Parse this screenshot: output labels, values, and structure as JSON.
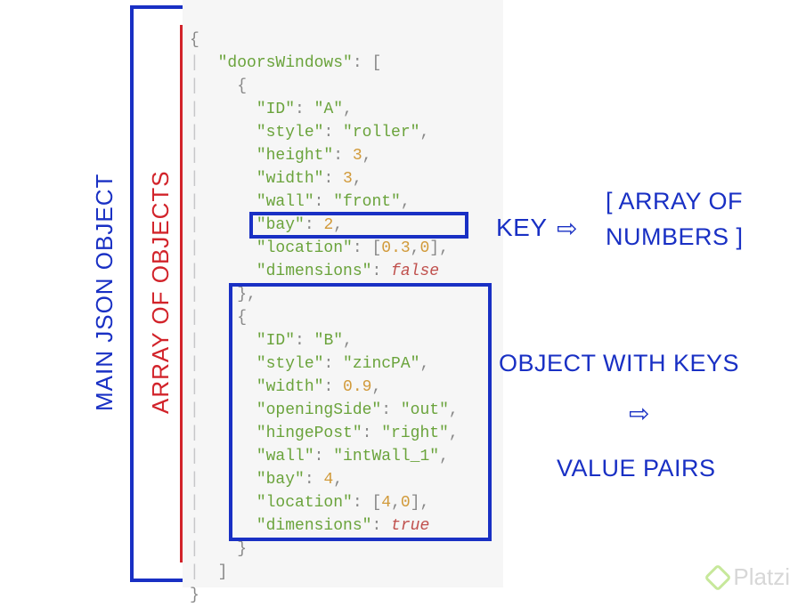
{
  "labels": {
    "main_json_object": "MAIN JSON OBJECT",
    "array_of_objects": "ARRAY OF OBJECTS",
    "key": "KEY",
    "array_of_numbers_l1": "[ ARRAY OF",
    "array_of_numbers_l2": "NUMBERS ]",
    "object_keys": "OBJECT WITH KEYS",
    "value_pairs": "VALUE PAIRS",
    "arrow_glyph": "⇨"
  },
  "code": {
    "outer_open": "{",
    "outer_close": "}",
    "key_doorsWindows": "\"doorsWindows\"",
    "arr_open": "[",
    "arr_close": "]",
    "obj_open": "{",
    "obj_close_comma": "},",
    "obj_close": "}",
    "colon_space": ": ",
    "comma": ",",
    "itemA": {
      "k_ID": "\"ID\"",
      "v_ID": "\"A\"",
      "k_style": "\"style\"",
      "v_style": "\"roller\"",
      "k_height": "\"height\"",
      "v_height": "3",
      "k_width": "\"width\"",
      "v_width": "3",
      "k_wall": "\"wall\"",
      "v_wall": "\"front\"",
      "k_bay": "\"bay\"",
      "v_bay": "2",
      "k_location": "\"location\"",
      "v_loc_open": "[",
      "v_loc_a": "0.3",
      "v_loc_sep": ",",
      "v_loc_b": "0",
      "v_loc_close": "]",
      "k_dimensions": "\"dimensions\"",
      "v_dimensions": "false"
    },
    "itemB": {
      "k_ID": "\"ID\"",
      "v_ID": "\"B\"",
      "k_style": "\"style\"",
      "v_style": "\"zincPA\"",
      "k_width": "\"width\"",
      "v_width": "0.9",
      "k_openingSide": "\"openingSide\"",
      "v_openingSide": "\"out\"",
      "k_hingePost": "\"hingePost\"",
      "v_hingePost": "\"right\"",
      "k_wall": "\"wall\"",
      "v_wall": "\"intWall_1\"",
      "k_bay": "\"bay\"",
      "v_bay": "4",
      "k_location": "\"location\"",
      "v_loc_open": "[",
      "v_loc_a": "4",
      "v_loc_sep": ",",
      "v_loc_b": "0",
      "v_loc_close": "]",
      "k_dimensions": "\"dimensions\"",
      "v_dimensions": "true"
    }
  },
  "watermark": "Platzi"
}
